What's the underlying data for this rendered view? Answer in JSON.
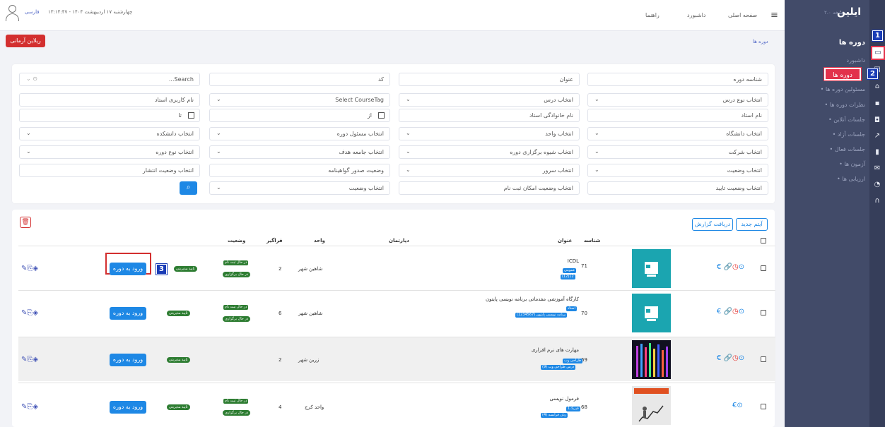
{
  "sidebar": {
    "brand": "ایلین",
    "version": "نسخه ۲.۰",
    "section_title": "دوره ها",
    "items": [
      {
        "label": "داشبورد"
      },
      {
        "label": "دوره ها"
      },
      {
        "label": "مسئولین دوره ها"
      },
      {
        "label": "نظرات دوره ها"
      },
      {
        "label": "جلسات آنلاین"
      },
      {
        "label": "جلسات آزاد"
      },
      {
        "label": "جلسات فعال"
      },
      {
        "label": "آزمون ها"
      },
      {
        "label": "ارزیابی ها"
      }
    ],
    "step_badges": [
      "1",
      "2"
    ]
  },
  "header": {
    "nav": [
      {
        "label": "صفحه اصلی"
      },
      {
        "label": "داشبورد"
      },
      {
        "label": "راهنما"
      }
    ],
    "datetime": "چهارشنبه ۱۷ اردیبهشت ۱۴۰۴ - ۱۳:۱۴:۴۷",
    "language": "فارسی"
  },
  "breadcrumb": "دوره ها",
  "top_button": "ریلاین آرمانی",
  "filters": {
    "row1": [
      "شناسه دوره",
      "عنوان",
      "کد",
      "...Search"
    ],
    "row2": [
      "انتخاب نوع درس",
      "انتخاب درس",
      "Select CourseTag",
      "نام کاربری استاد"
    ],
    "row3": [
      "نام استاد",
      "نام خانوادگی استاد",
      "از",
      "تا"
    ],
    "row4": [
      "انتخاب دانشگاه",
      "انتخاب واحد",
      "انتخاب مسئول دوره",
      "انتخاب دانشکده"
    ],
    "row5": [
      "انتخاب شرکت",
      "انتخاب شیوه برگزاری دوره",
      "انتخاب جامعه هدف",
      "انتخاب نوع دوره"
    ],
    "row6": [
      "انتخاب وضعیت",
      "انتخاب سرور",
      "وضعیت صدور گواهینامه",
      "انتخاب وضعیت انتشار"
    ],
    "row7": [
      "انتخاب وضعیت تایید",
      "انتخاب وضعیت امکان ثبت نام",
      "انتخاب وضعیت"
    ]
  },
  "table": {
    "new_item_label": "آیتم جدید",
    "report_label": "دریافت گزارش",
    "headers": {
      "id": "شناسه",
      "title": "عنوان",
      "department": "دپارتمان",
      "unit": "واحد",
      "learners": "فراگیر",
      "status": "وضعیت"
    },
    "enter_label": "ورود به دوره",
    "approve_label": "تایید مدیریتی",
    "status_reg": "در حال ثبت نام",
    "status_run": "در حال برگزاری",
    "step_badge": "3",
    "rows": [
      {
        "id": "71",
        "title": "ICDL",
        "tags": [
          "عمومی",
          "(12)12"
        ],
        "unit": "شاهین شهر",
        "learners": "2"
      },
      {
        "id": "70",
        "title": "کارگاه آموزشی مقدماتی برنامه نویسی پایتون",
        "tags": [
          "استاد",
          "برنامه نویسی پایتون (1234567)"
        ],
        "unit": "شاهین شهر",
        "learners": "6"
      },
      {
        "id": "69",
        "title": "مهارت های نرم افزاری",
        "tags": [
          "طراحی وب",
          "درس طراحی وب (9)"
        ],
        "unit": "زرین شهر",
        "learners": "2"
      },
      {
        "id": "68",
        "title": "فرمول نویسی",
        "tags": [
          "فیزیک1",
          "زبان فرانسه (4)"
        ],
        "unit": "واحد کرج",
        "learners": "4"
      }
    ]
  },
  "colors": {
    "sidebar": "#424b69",
    "accent": "#1e88e5",
    "danger": "#d32f2f",
    "success": "#2e7d32"
  }
}
